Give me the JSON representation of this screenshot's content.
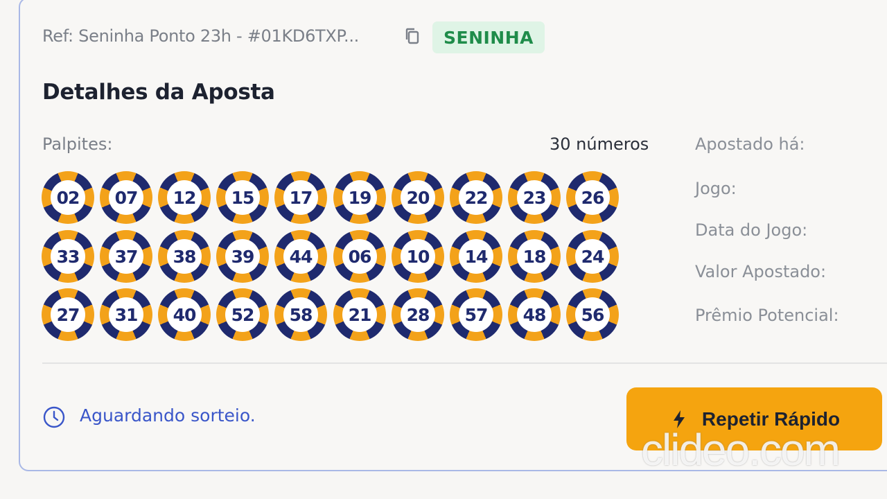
{
  "header": {
    "ref_text": "Ref: Seninha Ponto 23h - #01KD6TXP...",
    "badge": "SENINHA"
  },
  "section_title": "Detalhes da Aposta",
  "palpites": {
    "label": "Palpites:",
    "count_text": "30 números",
    "numbers": [
      "02",
      "07",
      "12",
      "15",
      "17",
      "19",
      "20",
      "22",
      "23",
      "26",
      "33",
      "37",
      "38",
      "39",
      "44",
      "06",
      "10",
      "14",
      "18",
      "24",
      "27",
      "31",
      "40",
      "52",
      "58",
      "21",
      "28",
      "57",
      "48",
      "56"
    ]
  },
  "info_labels": [
    "Apostado há:",
    "Jogo:",
    "Data do Jogo:",
    "Valor Apostado:",
    "Prêmio Potencial:"
  ],
  "status_text": "Aguardando sorteio.",
  "repeat_button_label": "Repetir Rápido",
  "watermark": "clideo.com",
  "colors": {
    "accent_orange": "#f5a40f",
    "ball_blue": "#1f2a6e",
    "badge_green": "#1f8c4a",
    "status_blue": "#3a56c9"
  },
  "icons": [
    "copy-icon",
    "clock-icon",
    "lightning-icon"
  ]
}
